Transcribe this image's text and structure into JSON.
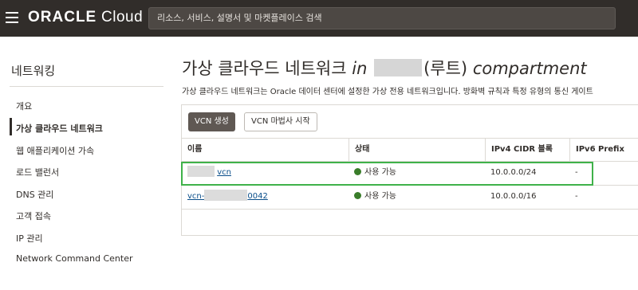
{
  "header": {
    "brand": "ORACLE",
    "product": "Cloud",
    "search_placeholder": "리소스, 서비스, 설명서 및 마켓플레이스 검색"
  },
  "sidebar": {
    "title": "네트워킹",
    "items": [
      {
        "label": "개요",
        "active": false
      },
      {
        "label": "가상 클라우드 네트워크",
        "active": true
      },
      {
        "label": "웹 애플리케이션 가속",
        "active": false
      },
      {
        "label": "로드 밸런서",
        "active": false
      },
      {
        "label": "DNS 관리",
        "active": false
      },
      {
        "label": "고객 접속",
        "active": false
      },
      {
        "label": "IP 관리",
        "active": false
      },
      {
        "label": "Network Command Center",
        "active": false
      }
    ]
  },
  "main": {
    "title_prefix": "가상 클라우드 네트워크",
    "title_in": "in",
    "title_root": "(루트)",
    "title_compartment": "compartment",
    "description": "가상 클라우드 네트워크는 Oracle 데이터 센터에 설정한 가상 전용 네트워크입니다. 방화벽 규칙과 특정 유형의 통신 게이트",
    "buttons": {
      "create": "VCN 생성",
      "wizard": "VCN 마법사 시작"
    },
    "table": {
      "columns": [
        "이름",
        "상태",
        "IPv4 CIDR 블록",
        "IPv6 Prefix"
      ],
      "rows": [
        {
          "name_suffix": "vcn",
          "status": "사용 가능",
          "cidr": "10.0.0.0/24",
          "ipv6": "-"
        },
        {
          "name_prefix": "vcn-",
          "name_suffix": "0042",
          "status": "사용 가능",
          "cidr": "10.0.0.0/16",
          "ipv6": "-"
        }
      ]
    }
  },
  "colors": {
    "topbar": "#312d2a",
    "status_available": "#3a7d2a",
    "highlight": "#3fb24a",
    "link": "#0a4e8a"
  }
}
